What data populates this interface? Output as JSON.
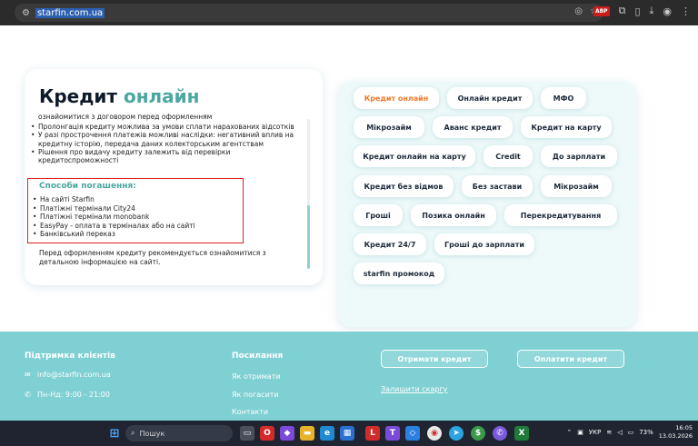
{
  "browser": {
    "url": "starfin.com.ua",
    "abp_label": "ABP"
  },
  "credit_card": {
    "title_main": "Кредит",
    "title_highlight": "онлайн",
    "intro_fragment": "ознайомитися з договором перед оформленням",
    "bullets": [
      "Пролонгація кредиту можлива за умови сплати нарахованих відсотків",
      "У разі прострочення платежів можливі наслідки: негативний вплив на кредитну історію, передача даних колекторським агентствам",
      "Рішення про видачу кредиту залежить від перевірки кредитоспроможності"
    ],
    "payment_title": "Способи погашення:",
    "payment_methods": [
      "На сайті Starfin",
      "Платіжні термінали City24",
      "Платіжні термінали monobank",
      "EasyPay - оплата в терміналах або на сайті",
      "Банківський переказ"
    ],
    "footnote": "Перед оформленням кредиту рекомендується ознайомитися з детальною інформацією на сайті."
  },
  "tags": [
    "Кредит онлайн",
    "Онлайн кредит",
    "МФО",
    "Мікрозайм",
    "Аванс кредит",
    "Кредит на карту",
    "Кредит онлайн на карту",
    "Credit",
    "До зарплати",
    "Кредит без відмов",
    "Без застави",
    "Мікрозайм",
    "Гроші",
    "Позика онлайн",
    "Перекредитування",
    "Кредит 24/7",
    "Гроші до зарплати",
    "starfin промокод"
  ],
  "footer": {
    "support_title": "Підтримка клієнтів",
    "email": "info@starfin.com.ua",
    "hours": "Пн-Нд: 9:00 - 21:00",
    "links_title": "Посилання",
    "links": [
      "Як отримати",
      "Як погасити",
      "Контакти"
    ],
    "btn_get": "Отримати кредит",
    "btn_pay": "Оплатити кредит",
    "leave_complaint": "Залишити скаргу"
  },
  "taskbar": {
    "search_placeholder": "Пошук",
    "language": "УКР",
    "battery": "73%",
    "time": "16:05",
    "date": "13.03.2026"
  },
  "colors": {
    "accent": "#4aa7a1",
    "active_tag": "#f07a2a",
    "footer_bg": "#7fd0d3",
    "highlight_box": "#e02020"
  }
}
